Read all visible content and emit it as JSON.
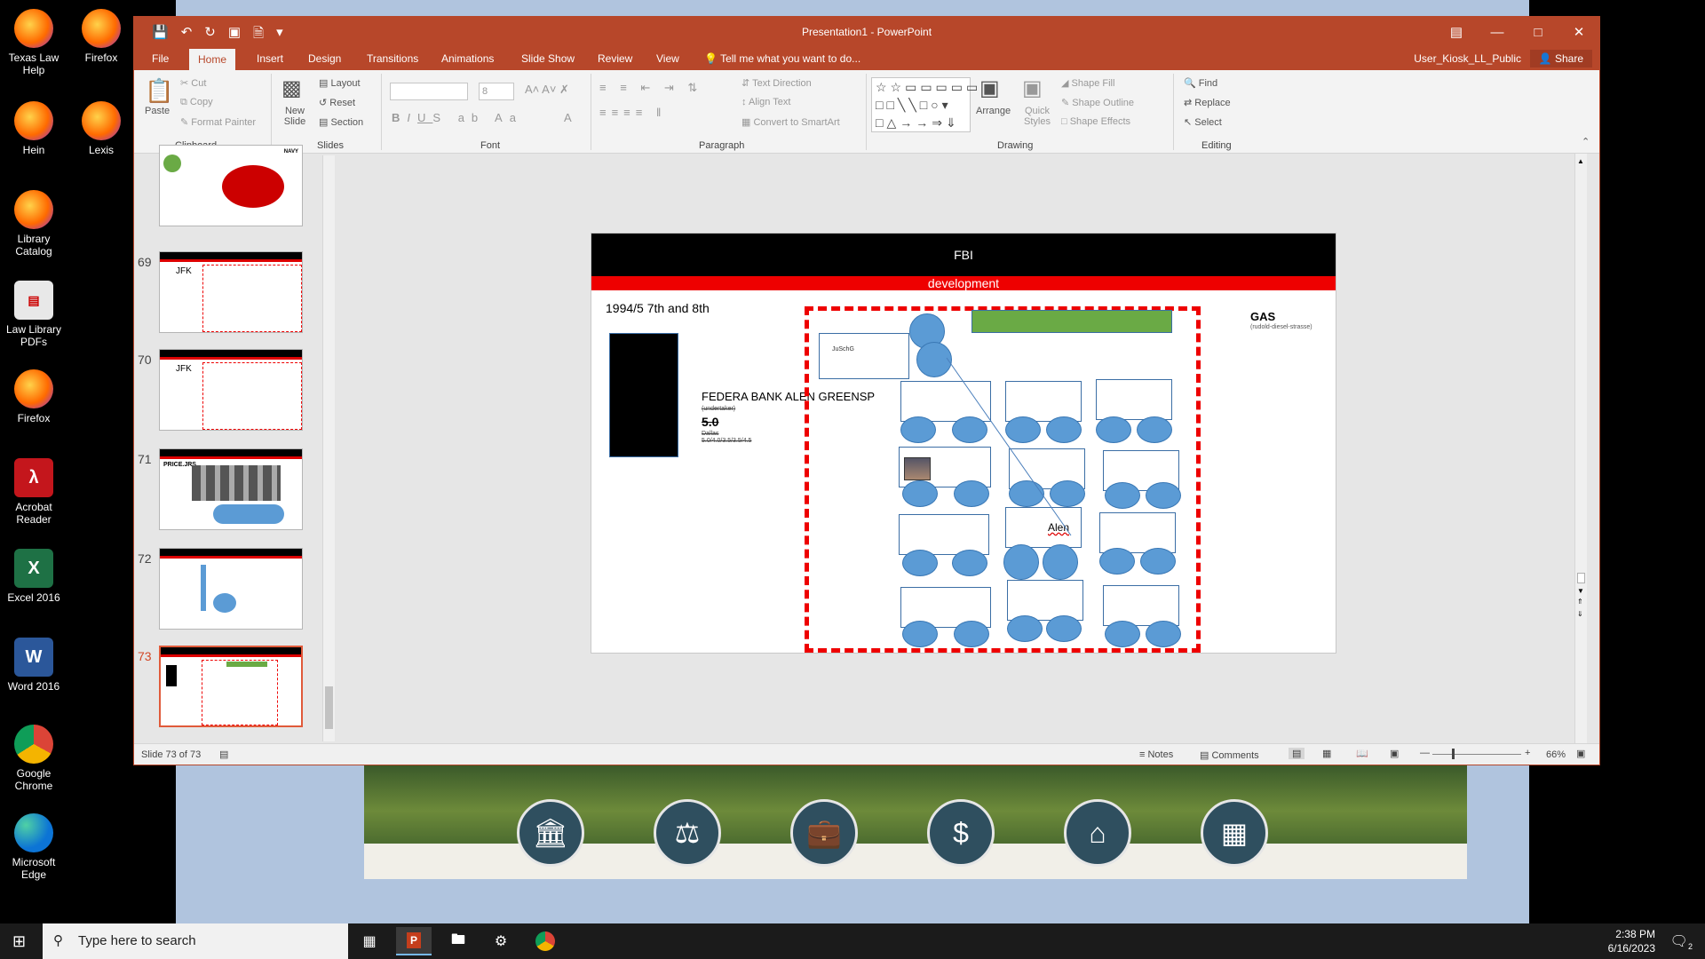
{
  "desktop": {
    "icons": [
      {
        "label": "Texas Law Help",
        "icon": "firefox-icon"
      },
      {
        "label": "Firefox",
        "icon": "firefox-icon"
      },
      {
        "label": "Hein",
        "icon": "firefox-icon"
      },
      {
        "label": "Lexis",
        "icon": "firefox-icon"
      },
      {
        "label": "Library Catalog",
        "icon": "firefox-icon"
      },
      {
        "label": "Law Library PDFs",
        "icon": "pdf-file-icon"
      },
      {
        "label": "Firefox",
        "icon": "firefox-icon"
      },
      {
        "label": "Acrobat Reader",
        "icon": "acrobat-icon"
      },
      {
        "label": "Excel 2016",
        "icon": "excel-icon"
      },
      {
        "label": "Word 2016",
        "icon": "word-icon"
      },
      {
        "label": "Google Chrome",
        "icon": "chrome-icon"
      },
      {
        "label": "Microsoft Edge",
        "icon": "edge-icon"
      }
    ]
  },
  "window": {
    "title": "Presentation1 - PowerPoint",
    "user": "User_Kiosk_LL_Public",
    "share": "Share",
    "tell_me": "Tell me what you want to do...",
    "tabs": [
      "File",
      "Home",
      "Insert",
      "Design",
      "Transitions",
      "Animations",
      "Slide Show",
      "Review",
      "View"
    ],
    "accent": "#b7472a"
  },
  "ribbon": {
    "clipboard": {
      "paste": "Paste",
      "cut": "Cut",
      "copy": "Copy",
      "format_painter": "Format Painter",
      "label": "Clipboard"
    },
    "slides": {
      "new_slide": "New Slide",
      "layout": "Layout",
      "reset": "Reset",
      "section": "Section",
      "label": "Slides"
    },
    "font": {
      "size": "8",
      "label": "Font"
    },
    "paragraph": {
      "text_direction": "Text Direction",
      "align_text": "Align Text",
      "smartart": "Convert to SmartArt",
      "label": "Paragraph"
    },
    "drawing": {
      "arrange": "Arrange",
      "quick_styles": "Quick Styles",
      "shape_fill": "Shape Fill",
      "shape_outline": "Shape Outline",
      "shape_effects": "Shape Effects",
      "label": "Drawing"
    },
    "editing": {
      "find": "Find",
      "replace": "Replace",
      "select": "Select",
      "label": "Editing"
    }
  },
  "thumbnails": [
    {
      "num": "",
      "tag": "NAVY"
    },
    {
      "num": "69",
      "tag": "JFK"
    },
    {
      "num": "70",
      "tag": "JFK"
    },
    {
      "num": "71",
      "tag": "PRICE.JRS"
    },
    {
      "num": "72",
      "tag": ""
    },
    {
      "num": "73",
      "tag": ""
    }
  ],
  "slide": {
    "header": "FBI",
    "subheader": "development",
    "date": "1994/5  7th and 8th",
    "bank": "FEDERA BANK ALEN GREENSP",
    "small1": "(undertaker)",
    "five": "5.0",
    "small2": "Dallas",
    "small3": "5.0/4.0/3.5/3.5/4.5",
    "gas": "GAS",
    "gas_sub": "(rudold-diesel-strasse)",
    "jusch": "JuSchG",
    "alen": "Alen"
  },
  "status": {
    "slide_info": "Slide 73 of 73",
    "notes": "Notes",
    "comments": "Comments",
    "zoom": "66%"
  },
  "taskbar": {
    "search_placeholder": "Type here to search",
    "time": "2:38 PM",
    "date": "6/16/2023",
    "notification_count": "2"
  }
}
